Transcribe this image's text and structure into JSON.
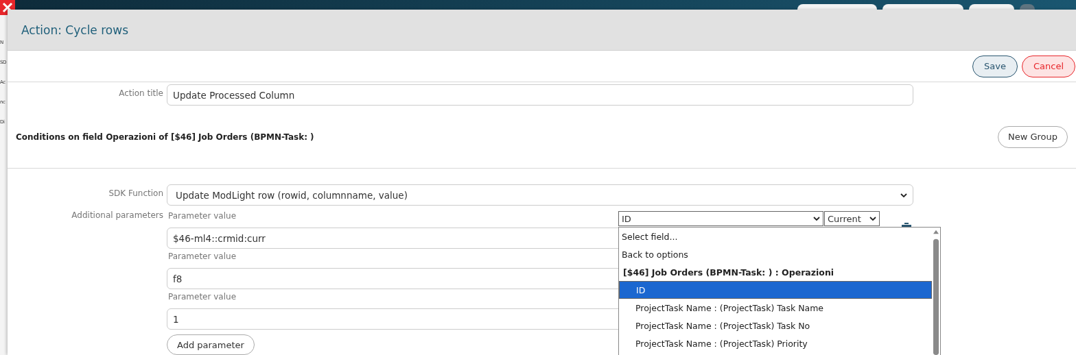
{
  "background": {
    "fragments": [
      "N",
      "SD",
      "Ac",
      "nc",
      "Di"
    ]
  },
  "dialog": {
    "title": "Action: Cycle rows",
    "buttons": [
      {
        "label": "Save",
        "kind": "save"
      },
      {
        "label": "Cancel",
        "kind": "cancel"
      }
    ]
  },
  "action_title": {
    "label": "Action title",
    "value": "Update Processed Column"
  },
  "conditions": {
    "heading": "Conditions on field Operazioni of [$46] Job Orders (BPMN-Task: )",
    "button": "New Group"
  },
  "sdk_function": {
    "label": "SDK Function",
    "value": "Update ModLight row (rowid, columnname, value)"
  },
  "parameters": {
    "label": "Additional parameters",
    "items": [
      {
        "caption": "Parameter value",
        "value": "$46-ml4::crmid:curr"
      },
      {
        "caption": "Parameter value",
        "value": "f8"
      },
      {
        "caption": "Parameter value",
        "value": "1"
      }
    ],
    "add_button": "Add parameter"
  },
  "field_picker": {
    "field": "ID",
    "scope": "Current",
    "options": [
      {
        "kind": "action",
        "label": "Select field...",
        "selected": false
      },
      {
        "kind": "action",
        "label": "Back to options",
        "selected": false
      },
      {
        "kind": "group",
        "label": "[$46] Job Orders (BPMN-Task: ) : Operazioni",
        "selected": false
      },
      {
        "kind": "field",
        "label": "ID",
        "selected": true
      },
      {
        "kind": "field",
        "label": "ProjectTask Name : (ProjectTask) Task Name",
        "selected": false
      },
      {
        "kind": "field",
        "label": "ProjectTask Name : (ProjectTask) Task No",
        "selected": false
      },
      {
        "kind": "field",
        "label": "ProjectTask Name : (ProjectTask) Priority",
        "selected": false
      }
    ]
  }
}
